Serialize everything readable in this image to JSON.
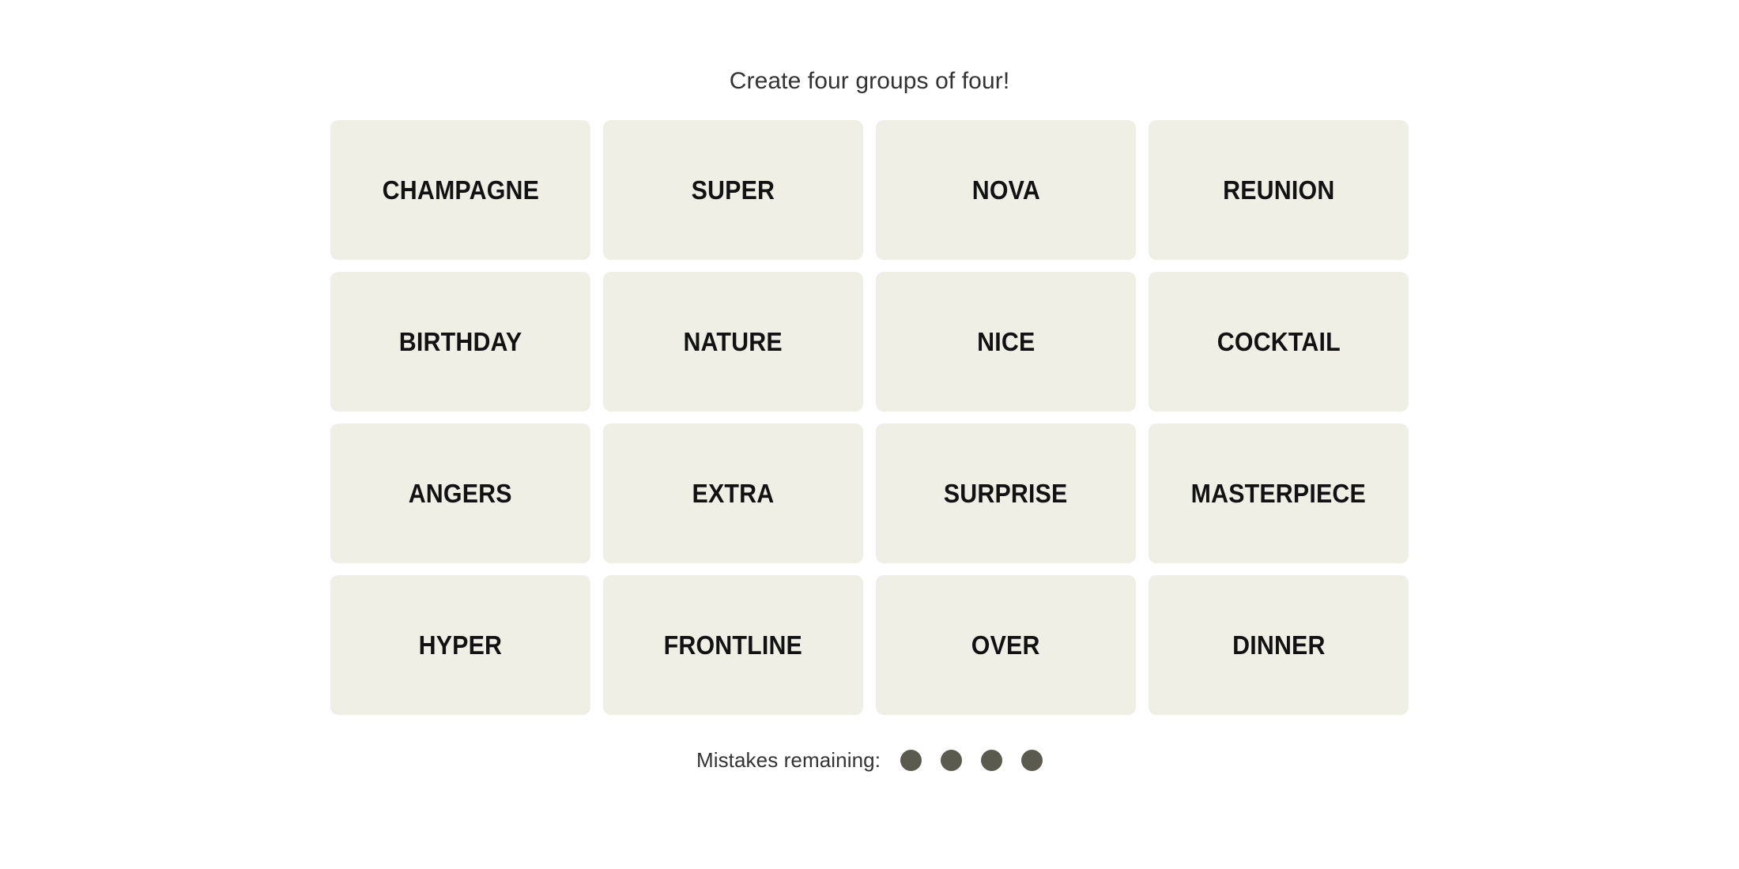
{
  "instruction": "Create four groups of four!",
  "board": {
    "rows": 4,
    "columns": 4,
    "tiles": [
      {
        "label": "CHAMPAGNE"
      },
      {
        "label": "SUPER"
      },
      {
        "label": "NOVA"
      },
      {
        "label": "REUNION"
      },
      {
        "label": "BIRTHDAY"
      },
      {
        "label": "NATURE"
      },
      {
        "label": "NICE"
      },
      {
        "label": "COCKTAIL"
      },
      {
        "label": "ANGERS"
      },
      {
        "label": "EXTRA"
      },
      {
        "label": "SURPRISE"
      },
      {
        "label": "MASTERPIECE"
      },
      {
        "label": "HYPER"
      },
      {
        "label": "FRONTLINE"
      },
      {
        "label": "OVER"
      },
      {
        "label": "DINNER"
      }
    ]
  },
  "footer": {
    "mistakes_label": "Mistakes remaining:",
    "mistakes_remaining": 4,
    "dots": [
      {
        "name": "mistake-dot-1"
      },
      {
        "name": "mistake-dot-2"
      },
      {
        "name": "mistake-dot-3"
      },
      {
        "name": "mistake-dot-4"
      }
    ]
  },
  "colors": {
    "page_background": "#FFFFFF",
    "tile_background": "#EFEFE6",
    "tile_text": "#121212",
    "body_text": "#333333",
    "dot": "#5A5A4E"
  }
}
